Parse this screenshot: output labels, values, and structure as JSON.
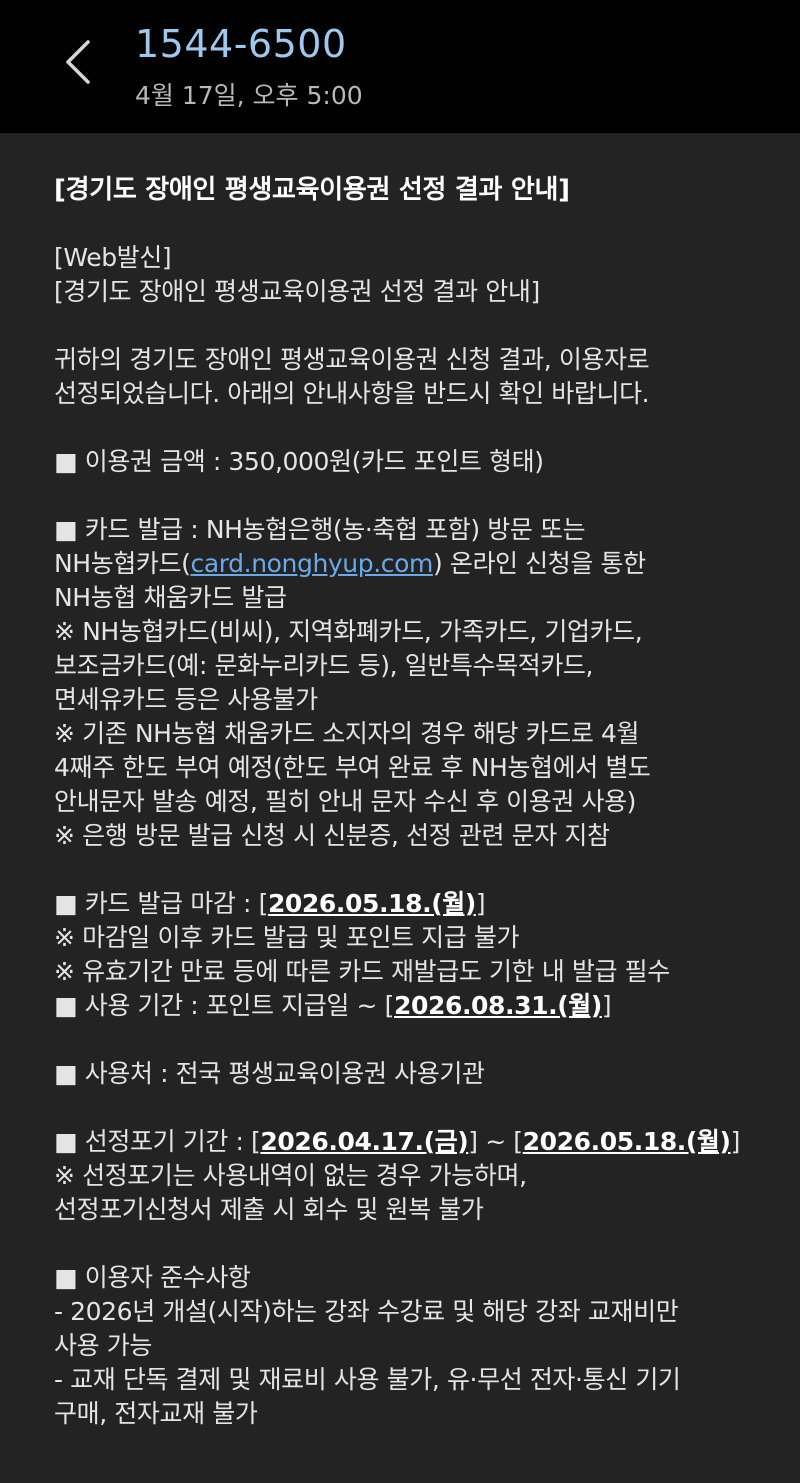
{
  "header": {
    "sender": "1544-6500",
    "timestamp": "4월 17일, 오후 5:00",
    "back_icon": "chevron-left-icon"
  },
  "message": {
    "title": "[경기도 장애인 평생교육이용권 선정 결과 안내]",
    "web_tag": "[Web발신]",
    "subtitle": "[경기도 장애인 평생교육이용권 선정 결과 안내]",
    "intro": [
      "귀하의 경기도 장애인 평생교육이용권 신청 결과, 이용자로",
      "선정되었습니다. 아래의 안내사항을 반드시 확인 바랍니다."
    ],
    "amount": "■ 이용권 금액 : 350,000원(카드 포인트 형태)",
    "card_issue": {
      "line1": "■ 카드 발급 : NH농협은행(농·축협 포함) 방문 또는",
      "line2_prefix": "NH농협카드(",
      "link": "card.nonghyup.com",
      "line2_suffix": ") 온라인 신청을 통한",
      "line3": "NH농협 채움카드 발급",
      "notes": [
        "※ NH농협카드(비씨), 지역화폐카드, 가족카드, 기업카드,",
        "보조금카드(예: 문화누리카드 등), 일반특수목적카드,",
        "면세유카드 등은 사용불가",
        "※ 기존 NH농협 채움카드 소지자의 경우 해당 카드로 4월",
        "4째주 한도 부여 예정(한도 부여 완료 후 NH농협에서 별도",
        "안내문자 발송 예정, 필히 안내 문자 수신 후 이용권 사용)",
        "※ 은행 방문 발급 신청 시 신분증, 선정 관련 문자 지참"
      ]
    },
    "deadline": {
      "prefix": "■ 카드 발급 마감 : [",
      "date": "2026.05.18.(월)",
      "suffix": "]",
      "notes": [
        "※ 마감일 이후 카드 발급 및 포인트 지급 불가",
        "※ 유효기간 만료 등에 따른 카드 재발급도 기한 내 발급 필수"
      ]
    },
    "period": {
      "prefix": "■ 사용 기간 : 포인트 지급일 ~ [",
      "date": "2026.08.31.(월)",
      "suffix": "]"
    },
    "place": "■ 사용처 : 전국 평생교육이용권 사용기관",
    "giveup": {
      "prefix": "■ 선정포기 기간 : [",
      "date1": "2026.04.17.(금)",
      "middle": "] ~ [",
      "date2": "2026.05.18.(월)",
      "suffix": "]",
      "notes": [
        "※ 선정포기는 사용내역이 없는 경우 가능하며,",
        "선정포기신청서 제출 시 회수 및 원복 불가"
      ]
    },
    "rules": {
      "heading": "■ 이용자 준수사항",
      "items": [
        "- 2026년 개설(시작)하는 강좌 수강료 및 해당 강좌 교재비만",
        "사용 가능",
        "- 교재 단독 결제 및 재료비 사용 불가, 유·무선 전자·통신 기기",
        "구매, 전자교재 불가"
      ]
    }
  }
}
